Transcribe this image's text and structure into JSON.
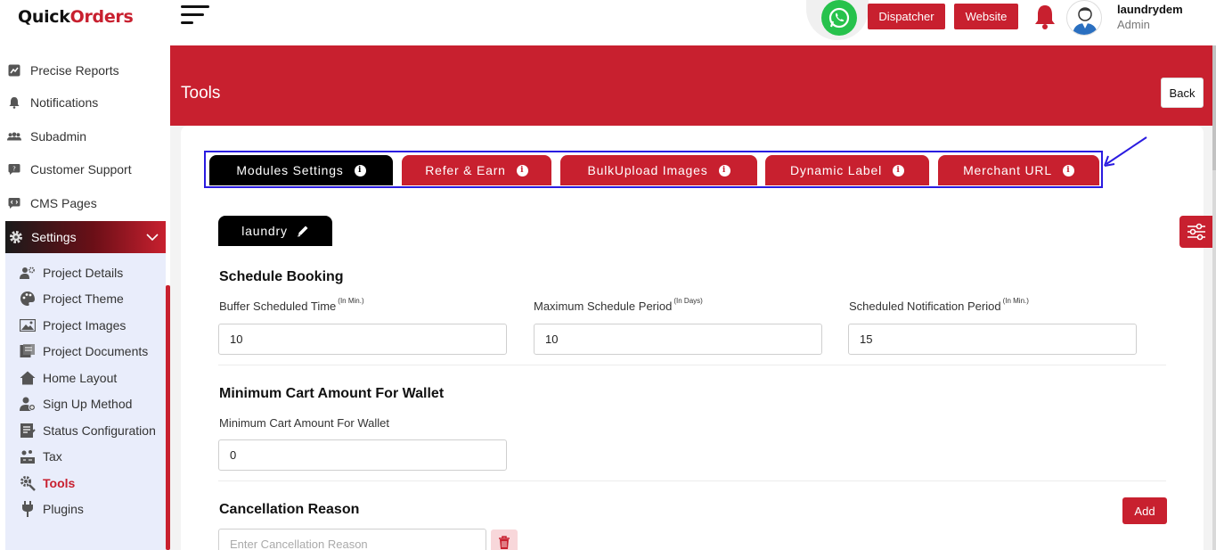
{
  "brand": {
    "logo_part1": "Quick",
    "logo_part2": "Orders"
  },
  "sidebar": {
    "items": [
      {
        "label": "Precise Reports",
        "icon": "chart-icon"
      },
      {
        "label": "Notifications",
        "icon": "bell-icon"
      },
      {
        "label": "Subadmin",
        "icon": "users-icon"
      },
      {
        "label": "Customer Support",
        "icon": "chat-icon"
      },
      {
        "label": "CMS Pages",
        "icon": "code-icon"
      }
    ],
    "settings": {
      "label": "Settings",
      "icon": "gear-icon",
      "expanded": true
    },
    "submenu": [
      {
        "label": "Project Details",
        "icon": "person-gear-icon"
      },
      {
        "label": "Project Theme",
        "icon": "palette-icon"
      },
      {
        "label": "Project Images",
        "icon": "image-icon"
      },
      {
        "label": "Project Documents",
        "icon": "documents-icon"
      },
      {
        "label": "Home Layout",
        "icon": "home-icon"
      },
      {
        "label": "Sign Up Method",
        "icon": "user-add-icon"
      },
      {
        "label": "Status Configuration",
        "icon": "status-icon"
      },
      {
        "label": "Tax",
        "icon": "tax-icon"
      },
      {
        "label": "Tools",
        "icon": "tools-icon",
        "active": true
      },
      {
        "label": "Plugins",
        "icon": "plug-icon"
      }
    ]
  },
  "header": {
    "dispatcher_label": "Dispatcher",
    "website_label": "Website",
    "user_name": "laundrydem",
    "user_role": "Admin"
  },
  "page": {
    "title": "Tools",
    "back_label": "Back"
  },
  "tabs": [
    {
      "label": "Modules Settings",
      "active": true
    },
    {
      "label": "Refer & Earn",
      "active": false
    },
    {
      "label": "BulkUpload Images",
      "active": false
    },
    {
      "label": "Dynamic Label",
      "active": false
    },
    {
      "label": "Merchant URL",
      "active": false
    }
  ],
  "module_tab": {
    "label": "laundry"
  },
  "schedule_booking": {
    "title": "Schedule Booking",
    "fields": [
      {
        "label": "Buffer Scheduled Time",
        "unit": "(In Min.)",
        "value": "10"
      },
      {
        "label": "Maximum Schedule Period",
        "unit": "(In Days)",
        "value": "10"
      },
      {
        "label": "Scheduled Notification Period",
        "unit": "(In Min.)",
        "value": "15"
      }
    ]
  },
  "min_cart": {
    "title": "Minimum Cart Amount For Wallet",
    "field_label": "Minimum Cart Amount For Wallet",
    "value": "0"
  },
  "cancellation": {
    "title": "Cancellation Reason",
    "add_label": "Add",
    "placeholder": "Enter Cancellation Reason"
  },
  "colors": {
    "primary": "#c8202f",
    "highlight": "#2a1be0",
    "whatsapp": "#27c24c"
  }
}
